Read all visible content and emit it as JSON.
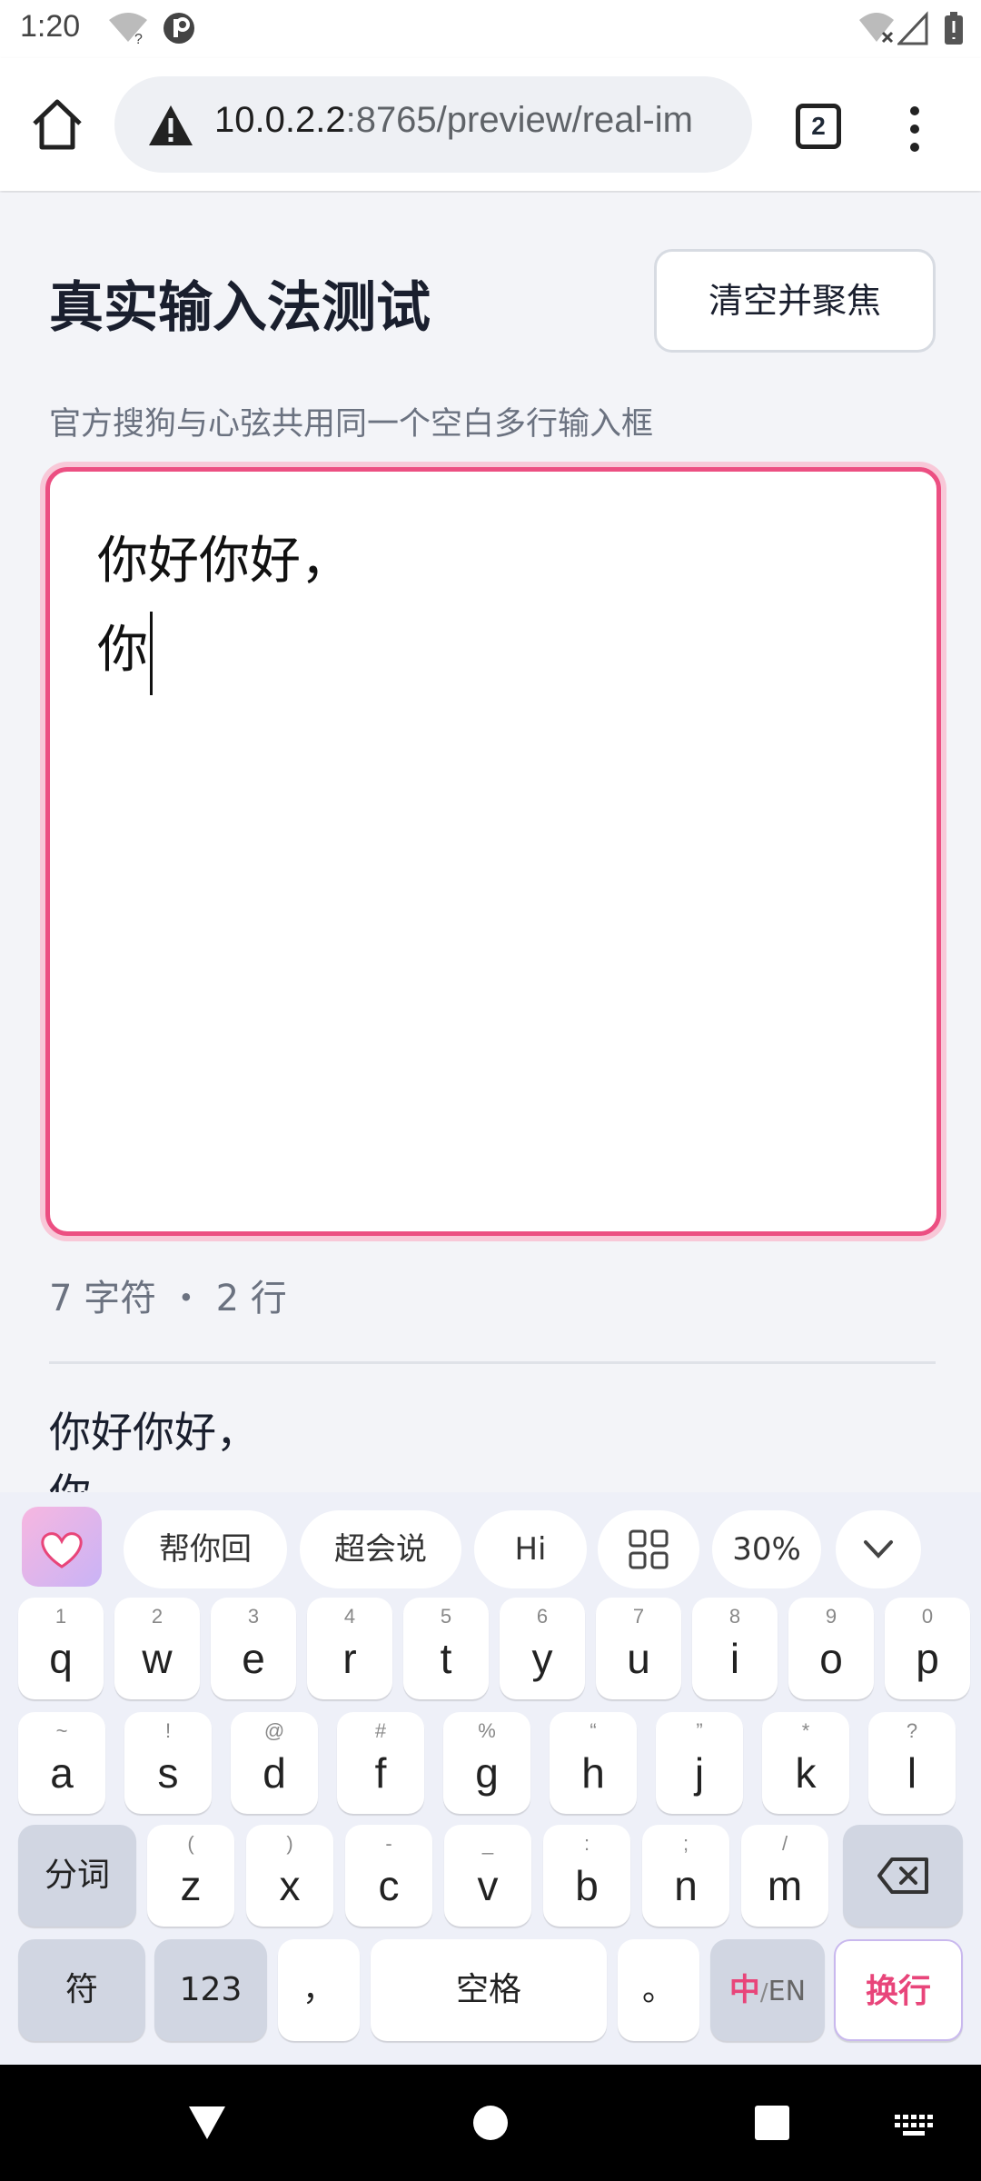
{
  "status_bar": {
    "time": "1:20",
    "icons": [
      "wifi-question-icon",
      "app-notification-icon",
      "wifi-off-icon",
      "signal-icon",
      "battery-icon"
    ]
  },
  "browser": {
    "url_host": "10.0.2.2",
    "url_rest": ":8765/preview/real-im",
    "tab_count": "2"
  },
  "page": {
    "title": "真实输入法测试",
    "clear_button": "清空并聚焦",
    "subtitle": "官方搜狗与心弦共用同一个空白多行输入框",
    "textarea_line1": "你好你好，",
    "textarea_line2": "你",
    "counter": "7 字符 ・ 2 行",
    "preview_text": "你好你好，\n你"
  },
  "keyboard": {
    "chips": [
      "帮你回",
      "超会说",
      "Hi",
      "30%"
    ],
    "row1": [
      {
        "k": "q",
        "h": "1"
      },
      {
        "k": "w",
        "h": "2"
      },
      {
        "k": "e",
        "h": "3"
      },
      {
        "k": "r",
        "h": "4"
      },
      {
        "k": "t",
        "h": "5"
      },
      {
        "k": "y",
        "h": "6"
      },
      {
        "k": "u",
        "h": "7"
      },
      {
        "k": "i",
        "h": "8"
      },
      {
        "k": "o",
        "h": "9"
      },
      {
        "k": "p",
        "h": "0"
      }
    ],
    "row2": [
      {
        "k": "a",
        "h": "~"
      },
      {
        "k": "s",
        "h": "!"
      },
      {
        "k": "d",
        "h": "@"
      },
      {
        "k": "f",
        "h": "#"
      },
      {
        "k": "g",
        "h": "%"
      },
      {
        "k": "h",
        "h": "“"
      },
      {
        "k": "j",
        "h": "”"
      },
      {
        "k": "k",
        "h": "*"
      },
      {
        "k": "l",
        "h": "?"
      }
    ],
    "row3_left": "分词",
    "row3": [
      {
        "k": "z",
        "h": "("
      },
      {
        "k": "x",
        "h": ")"
      },
      {
        "k": "c",
        "h": "-"
      },
      {
        "k": "v",
        "h": "_"
      },
      {
        "k": "b",
        "h": ":"
      },
      {
        "k": "n",
        "h": ";"
      },
      {
        "k": "m",
        "h": "/"
      }
    ],
    "symbols": "符",
    "numbers": "123",
    "comma": "，",
    "space": "空格",
    "period": "。",
    "lang_zh": "中",
    "lang_sep": "/",
    "lang_en": "EN",
    "enter": "换行",
    "accent": "#e8457a"
  }
}
